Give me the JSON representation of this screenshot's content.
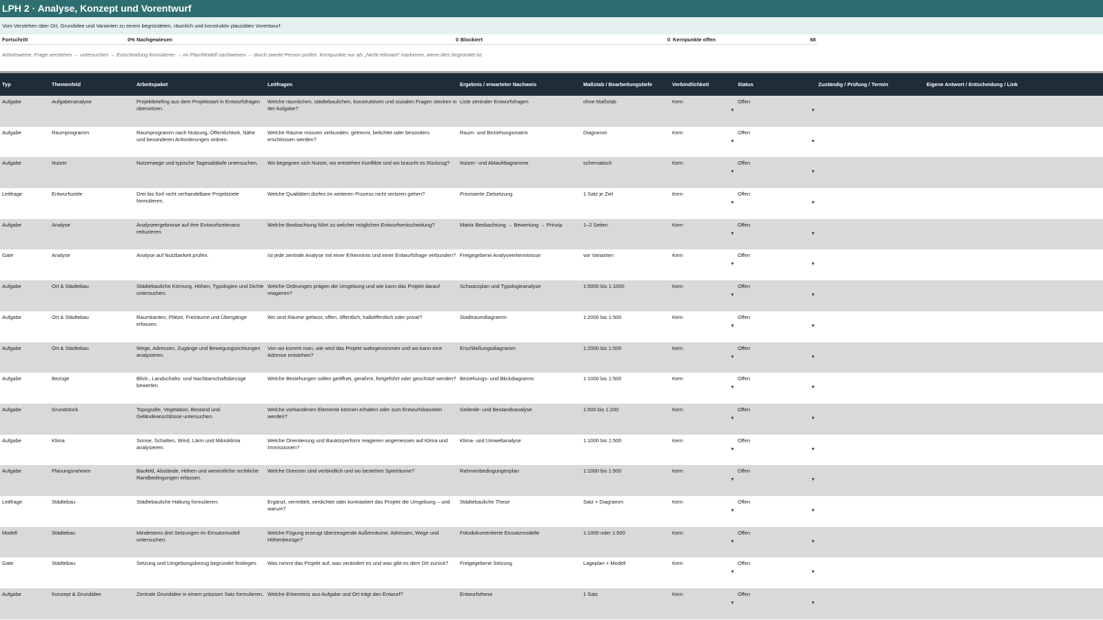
{
  "sheet": {
    "title": "LPH 2 · Analyse, Konzept und Vorentwurf",
    "subtitle": "Vom Verstehen über Ort, Grundidee und Varianten zu einem begründeten, räumlich und konstruktiv plausiblen Vorentwurf.",
    "hint": "Arbeitsweise: Frage verstehen → untersuchen → Entscheidung formulieren → im Plan/Modell nachweisen → durch zweite Person prüfen. Kernpunkte nur als „Nicht relevant“ markieren, wenn dies begründet ist."
  },
  "progress": {
    "label": "Fortschritt",
    "percent": "0%",
    "nachgewiesen_label": "Nachgewiesen",
    "blockiert_count": "0",
    "blockiert_label": "Blockiert",
    "kern_offen_count": "0",
    "kern_offen_label": "Kernpunkte offen",
    "total": "68"
  },
  "columns": [
    "Typ",
    "Themenfeld",
    "Arbeitspaket",
    "Leitfragen",
    "Ergebnis / erwarteter Nachweis",
    "Maßstab / Bearbeitungstiefe",
    "Verbindlichkeit",
    "Status",
    "Zuständig / Prüfung / Termin",
    "Eigene Antwort / Entscheidung / Link"
  ],
  "dropdown_icon": "chevron-down-icon",
  "dropdown_glyph": "▼",
  "rows": [
    {
      "typ": "Aufgabe",
      "thema": "Aufgabenanalyse",
      "paket": "Projektbriefing aus dem Projektstart in Entwurfsfragen übersetzen.",
      "frage": "Welche räumlichen, städtebaulichen, konstruktiven und sozialen Fragen stecken in der Aufgabe?",
      "ergebnis": "Liste zentraler Entwurfsfragen",
      "massstab": "ohne Maßstab",
      "verbindlichkeit": "Kern",
      "status": "Offen"
    },
    {
      "typ": "Aufgabe",
      "thema": "Raumprogramm",
      "paket": "Raumprogramm nach Nutzung, Öffentlichkeit, Nähe und besonderen Anforderungen ordnen.",
      "frage": "Welche Räume müssen verbunden, getrennt, belichtet oder besonders erschlossen werden?",
      "ergebnis": "Raum- und Beziehungsmatrix",
      "massstab": "Diagramm",
      "verbindlichkeit": "Kern",
      "status": "Offen"
    },
    {
      "typ": "Aufgabe",
      "thema": "Nutzer",
      "paket": "Nutzerwege und typische Tagesabläufe untersuchen.",
      "frage": "Wo begegnen sich Nutzer, wo entstehen Konflikte und wo braucht es Rückzug?",
      "ergebnis": "Nutzer- und Ablaufdiagramme",
      "massstab": "schematisch",
      "verbindlichkeit": "Kern",
      "status": "Offen"
    },
    {
      "typ": "Leitfrage",
      "thema": "Entwurfsziele",
      "paket": "Drei bis fünf nicht verhandelbare Projektziele formulieren.",
      "frage": "Welche Qualitäten dürfen im weiteren Prozess nicht verloren gehen?",
      "ergebnis": "Priorisierte Zielsetzung",
      "massstab": "1 Satz je Ziel",
      "verbindlichkeit": "Kern",
      "status": "Offen"
    },
    {
      "typ": "Aufgabe",
      "thema": "Analyse",
      "paket": "Analyseergebnisse auf ihre Entwurfsrelevanz reduzieren.",
      "frage": "Welche Beobachtung führt zu welcher möglichen Entwurfsentscheidung?",
      "ergebnis": "Matrix Beobachtung → Bewertung → Prinzip",
      "massstab": "1–2 Seiten",
      "verbindlichkeit": "Kern",
      "status": "Offen"
    },
    {
      "typ": "Gate",
      "thema": "Analyse",
      "paket": "Analyse auf Nutzbarkeit prüfen.",
      "frage": "Ist jede zentrale Analyse mit einer Erkenntnis und einer Entwurfsfrage verbunden?",
      "ergebnis": "Freigegebene Analyseerkenntnisse",
      "massstab": "vor Varianten",
      "verbindlichkeit": "Kern",
      "status": "Offen"
    },
    {
      "typ": "Aufgabe",
      "thema": "Ort & Städtebau",
      "paket": "Städtebauliche Körnung, Höhen, Typologien und Dichte untersuchen.",
      "frage": "Welche Ordnungen prägen die Umgebung und wie kann das Projekt darauf reagieren?",
      "ergebnis": "Schwarzplan und Typologieanalyse",
      "massstab": "1:5000 bis 1:1000",
      "verbindlichkeit": "Kern",
      "status": "Offen"
    },
    {
      "typ": "Aufgabe",
      "thema": "Ort & Städtebau",
      "paket": "Raumkanten, Plätze, Freiräume und Übergänge erfassen.",
      "frage": "Wo sind Räume gefasst, offen, öffentlich, halböffentlich oder privat?",
      "ergebnis": "Stadtraumdiagramm",
      "massstab": "1:2000 bis 1:500",
      "verbindlichkeit": "Kern",
      "status": "Offen"
    },
    {
      "typ": "Aufgabe",
      "thema": "Ort & Städtebau",
      "paket": "Wege, Adressen, Zugänge und Bewegungsrichtungen analysieren.",
      "frage": "Von wo kommt man, wie wird das Projekt wahrgenommen und wo kann eine Adresse entstehen?",
      "ergebnis": "Erschließungsdiagramm",
      "massstab": "1:2000 bis 1:500",
      "verbindlichkeit": "Kern",
      "status": "Offen"
    },
    {
      "typ": "Aufgabe",
      "thema": "Bezüge",
      "paket": "Blick-, Landschafts- und Nachbarschaftsbezüge bewerten.",
      "frage": "Welche Beziehungen sollen geöffnet, gerahmt, fortgeführt oder geschützt werden?",
      "ergebnis": "Beziehungs- und Blickdiagramm",
      "massstab": "1:1000 bis 1:500",
      "verbindlichkeit": "Kern",
      "status": "Offen"
    },
    {
      "typ": "Aufgabe",
      "thema": "Grundstück",
      "paket": "Topografie, Vegetation, Bestand und Geländeanschlüsse untersuchen.",
      "frage": "Welche vorhandenen Elemente können erhalten oder zum Entwurfsbaustein werden?",
      "ergebnis": "Gelände- und Bestandsanalyse",
      "massstab": "1:500 bis 1:200",
      "verbindlichkeit": "Kern",
      "status": "Offen"
    },
    {
      "typ": "Aufgabe",
      "thema": "Klima",
      "paket": "Sonne, Schatten, Wind, Lärm und Mikroklima analysieren.",
      "frage": "Welche Orientierung und Baukörperform reagieren angemessen auf Klima und Immissionen?",
      "ergebnis": "Klima- und Umweltanalyse",
      "massstab": "1:1000 bis 1:500",
      "verbindlichkeit": "Kern",
      "status": "Offen"
    },
    {
      "typ": "Aufgabe",
      "thema": "Planungsrahmen",
      "paket": "Baufeld, Abstände, Höhen und wesentliche rechtliche Randbedingungen erfassen.",
      "frage": "Welche Grenzen sind verbindlich und wo bestehen Spielräume?",
      "ergebnis": "Rahmenbedingungenplan",
      "massstab": "1:1000 bis 1:500",
      "verbindlichkeit": "Kern",
      "status": "Offen"
    },
    {
      "typ": "Leitfrage",
      "thema": "Städtebau",
      "paket": "Städtebauliche Haltung formulieren.",
      "frage": "Ergänzt, vermittelt, verdichtet oder kontrastiert das Projekt die Umgebung – und warum?",
      "ergebnis": "Städtebauliche These",
      "massstab": "Satz + Diagramm",
      "verbindlichkeit": "Kern",
      "status": "Offen"
    },
    {
      "typ": "Modell",
      "thema": "Städtebau",
      "paket": "Mindestens drei Setzungen im Einsatzmodell untersuchen.",
      "frage": "Welche Fügung erzeugt überzeugende Außenräume, Adressen, Wege und Höhenbezüge?",
      "ergebnis": "Fotodokumentierte Einsatzmodelle",
      "massstab": "1:1000 oder 1:500",
      "verbindlichkeit": "Kern",
      "status": "Offen"
    },
    {
      "typ": "Gate",
      "thema": "Städtebau",
      "paket": "Setzung und Umgebungsbezug begründet festlegen.",
      "frage": "Was nimmt das Projekt auf, was verändert es und was gibt es dem Ort zurück?",
      "ergebnis": "Freigegebene Setzung",
      "massstab": "Lageplan + Modell",
      "verbindlichkeit": "Kern",
      "status": "Offen"
    },
    {
      "typ": "Aufgabe",
      "thema": "Konzept & Grundidee",
      "paket": "Zentrale Grundidee in einem präzisen Satz formulieren.",
      "frage": "Welche Erkenntnis aus Aufgabe und Ort trägt den Entwurf?",
      "ergebnis": "Entwurfsthese",
      "massstab": "1 Satz",
      "verbindlichkeit": "Kern",
      "status": "Offen"
    }
  ]
}
